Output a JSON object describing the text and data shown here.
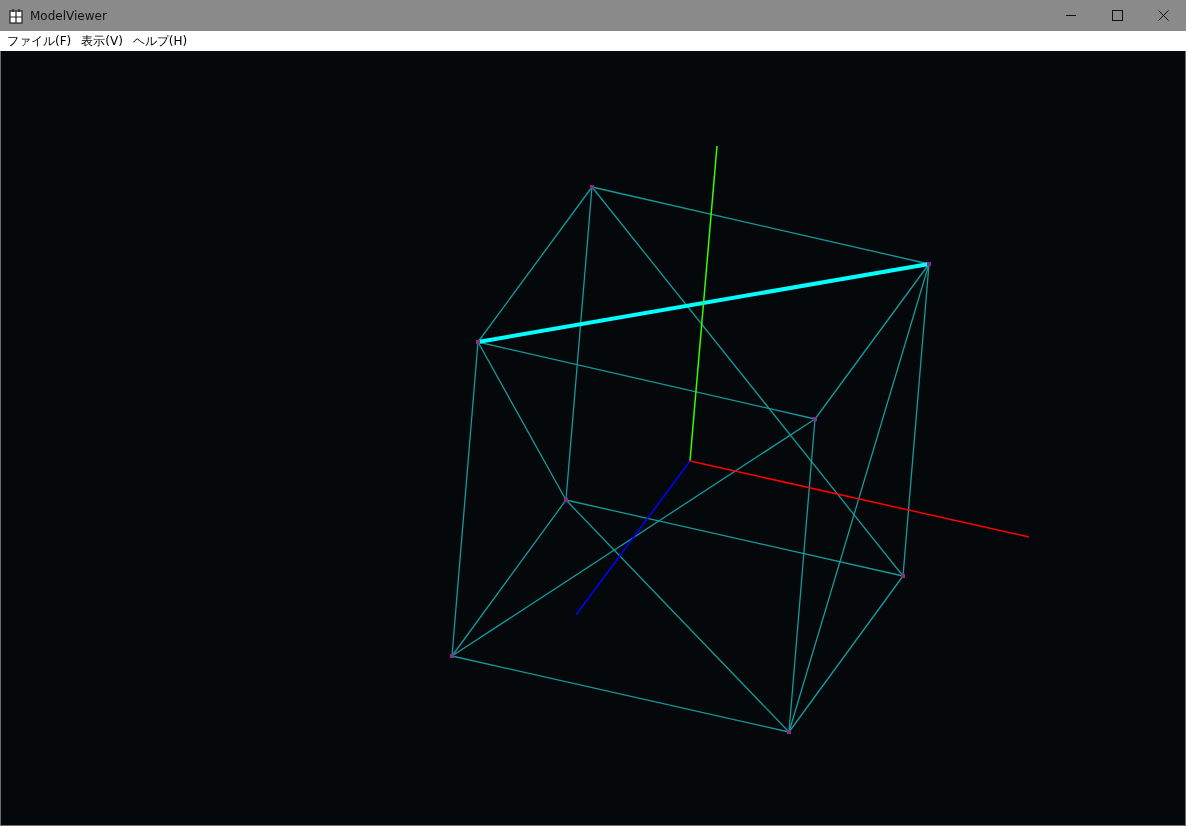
{
  "window": {
    "title": "ModelViewer"
  },
  "menu": [
    {
      "label": "ファイル(F)"
    },
    {
      "label": "表示(V)"
    },
    {
      "label": "ヘルプ(H)"
    }
  ]
}
